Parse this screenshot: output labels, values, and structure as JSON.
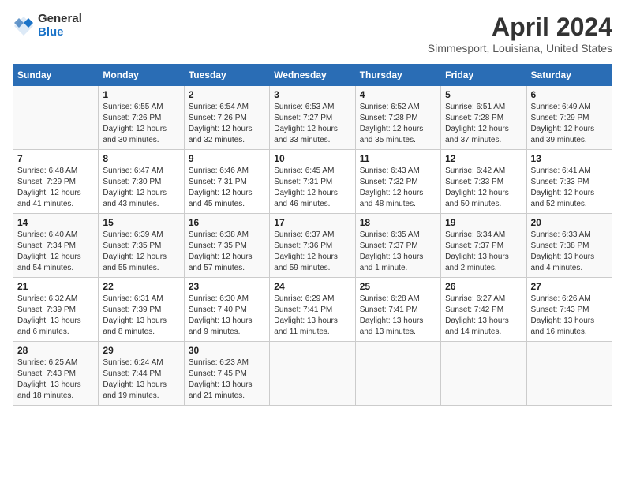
{
  "header": {
    "logo_general": "General",
    "logo_blue": "Blue",
    "month_year": "April 2024",
    "location": "Simmesport, Louisiana, United States"
  },
  "days_of_week": [
    "Sunday",
    "Monday",
    "Tuesday",
    "Wednesday",
    "Thursday",
    "Friday",
    "Saturday"
  ],
  "weeks": [
    [
      {
        "day": "",
        "info": ""
      },
      {
        "day": "1",
        "info": "Sunrise: 6:55 AM\nSunset: 7:26 PM\nDaylight: 12 hours\nand 30 minutes."
      },
      {
        "day": "2",
        "info": "Sunrise: 6:54 AM\nSunset: 7:26 PM\nDaylight: 12 hours\nand 32 minutes."
      },
      {
        "day": "3",
        "info": "Sunrise: 6:53 AM\nSunset: 7:27 PM\nDaylight: 12 hours\nand 33 minutes."
      },
      {
        "day": "4",
        "info": "Sunrise: 6:52 AM\nSunset: 7:28 PM\nDaylight: 12 hours\nand 35 minutes."
      },
      {
        "day": "5",
        "info": "Sunrise: 6:51 AM\nSunset: 7:28 PM\nDaylight: 12 hours\nand 37 minutes."
      },
      {
        "day": "6",
        "info": "Sunrise: 6:49 AM\nSunset: 7:29 PM\nDaylight: 12 hours\nand 39 minutes."
      }
    ],
    [
      {
        "day": "7",
        "info": "Sunrise: 6:48 AM\nSunset: 7:29 PM\nDaylight: 12 hours\nand 41 minutes."
      },
      {
        "day": "8",
        "info": "Sunrise: 6:47 AM\nSunset: 7:30 PM\nDaylight: 12 hours\nand 43 minutes."
      },
      {
        "day": "9",
        "info": "Sunrise: 6:46 AM\nSunset: 7:31 PM\nDaylight: 12 hours\nand 45 minutes."
      },
      {
        "day": "10",
        "info": "Sunrise: 6:45 AM\nSunset: 7:31 PM\nDaylight: 12 hours\nand 46 minutes."
      },
      {
        "day": "11",
        "info": "Sunrise: 6:43 AM\nSunset: 7:32 PM\nDaylight: 12 hours\nand 48 minutes."
      },
      {
        "day": "12",
        "info": "Sunrise: 6:42 AM\nSunset: 7:33 PM\nDaylight: 12 hours\nand 50 minutes."
      },
      {
        "day": "13",
        "info": "Sunrise: 6:41 AM\nSunset: 7:33 PM\nDaylight: 12 hours\nand 52 minutes."
      }
    ],
    [
      {
        "day": "14",
        "info": "Sunrise: 6:40 AM\nSunset: 7:34 PM\nDaylight: 12 hours\nand 54 minutes."
      },
      {
        "day": "15",
        "info": "Sunrise: 6:39 AM\nSunset: 7:35 PM\nDaylight: 12 hours\nand 55 minutes."
      },
      {
        "day": "16",
        "info": "Sunrise: 6:38 AM\nSunset: 7:35 PM\nDaylight: 12 hours\nand 57 minutes."
      },
      {
        "day": "17",
        "info": "Sunrise: 6:37 AM\nSunset: 7:36 PM\nDaylight: 12 hours\nand 59 minutes."
      },
      {
        "day": "18",
        "info": "Sunrise: 6:35 AM\nSunset: 7:37 PM\nDaylight: 13 hours\nand 1 minute."
      },
      {
        "day": "19",
        "info": "Sunrise: 6:34 AM\nSunset: 7:37 PM\nDaylight: 13 hours\nand 2 minutes."
      },
      {
        "day": "20",
        "info": "Sunrise: 6:33 AM\nSunset: 7:38 PM\nDaylight: 13 hours\nand 4 minutes."
      }
    ],
    [
      {
        "day": "21",
        "info": "Sunrise: 6:32 AM\nSunset: 7:39 PM\nDaylight: 13 hours\nand 6 minutes."
      },
      {
        "day": "22",
        "info": "Sunrise: 6:31 AM\nSunset: 7:39 PM\nDaylight: 13 hours\nand 8 minutes."
      },
      {
        "day": "23",
        "info": "Sunrise: 6:30 AM\nSunset: 7:40 PM\nDaylight: 13 hours\nand 9 minutes."
      },
      {
        "day": "24",
        "info": "Sunrise: 6:29 AM\nSunset: 7:41 PM\nDaylight: 13 hours\nand 11 minutes."
      },
      {
        "day": "25",
        "info": "Sunrise: 6:28 AM\nSunset: 7:41 PM\nDaylight: 13 hours\nand 13 minutes."
      },
      {
        "day": "26",
        "info": "Sunrise: 6:27 AM\nSunset: 7:42 PM\nDaylight: 13 hours\nand 14 minutes."
      },
      {
        "day": "27",
        "info": "Sunrise: 6:26 AM\nSunset: 7:43 PM\nDaylight: 13 hours\nand 16 minutes."
      }
    ],
    [
      {
        "day": "28",
        "info": "Sunrise: 6:25 AM\nSunset: 7:43 PM\nDaylight: 13 hours\nand 18 minutes."
      },
      {
        "day": "29",
        "info": "Sunrise: 6:24 AM\nSunset: 7:44 PM\nDaylight: 13 hours\nand 19 minutes."
      },
      {
        "day": "30",
        "info": "Sunrise: 6:23 AM\nSunset: 7:45 PM\nDaylight: 13 hours\nand 21 minutes."
      },
      {
        "day": "",
        "info": ""
      },
      {
        "day": "",
        "info": ""
      },
      {
        "day": "",
        "info": ""
      },
      {
        "day": "",
        "info": ""
      }
    ]
  ]
}
